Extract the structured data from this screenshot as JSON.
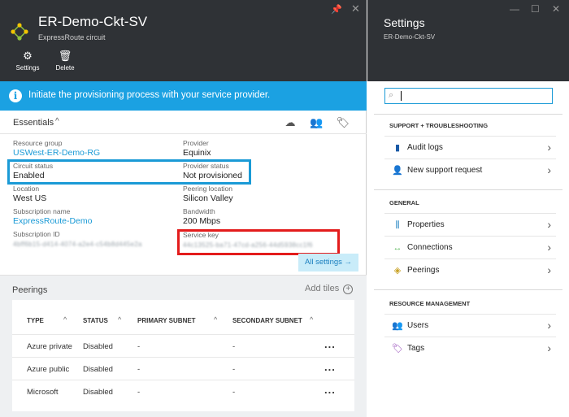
{
  "left_blade": {
    "title": "ER-Demo-Ckt-SV",
    "subtitle": "ExpressRoute circuit",
    "pin_glyph": "📌",
    "close_glyph": "✕",
    "toolbar": [
      {
        "label": "Settings",
        "icon": "gear-icon",
        "glyph": "⚙"
      },
      {
        "label": "Delete",
        "icon": "trash-icon",
        "glyph": "🗑"
      }
    ],
    "banner": {
      "icon": "info-icon",
      "glyph": "i",
      "text": "Initiate the provisioning process with your service provider."
    },
    "essentials": {
      "label": "Essentials",
      "chevron": "^",
      "icons": [
        {
          "name": "cloud-icon",
          "glyph": "☁"
        },
        {
          "name": "users-icon",
          "glyph": "👥"
        },
        {
          "name": "tag-icon",
          "glyph": "🏷"
        }
      ],
      "left_fields": [
        {
          "key": "Resource group",
          "value": "USWest-ER-Demo-RG",
          "link": true
        },
        {
          "key": "Circuit status",
          "value": "Enabled",
          "link": false
        },
        {
          "key": "Location",
          "value": "West US",
          "link": false
        },
        {
          "key": "Subscription name",
          "value": "ExpressRoute-Demo",
          "link": true
        },
        {
          "key": "Subscription ID",
          "value": "4bff6b15-d414-4074-a2e4-c54b8d445e2a",
          "link": false
        }
      ],
      "right_fields": [
        {
          "key": "Provider",
          "value": "Equinix"
        },
        {
          "key": "Provider status",
          "value": "Not provisioned"
        },
        {
          "key": "Peering location",
          "value": "Silicon Valley"
        },
        {
          "key": "Bandwidth",
          "value": "200 Mbps"
        },
        {
          "key": "Service key",
          "value": "44c13525-ba71-47cd-a256-44d5938cc1f6"
        }
      ],
      "all_settings": "All settings →"
    },
    "peerings": {
      "title": "Peerings",
      "add_tiles": "Add tiles",
      "add_glyph": "+",
      "sort_glyph": "^",
      "columns": [
        "TYPE",
        "STATUS",
        "PRIMARY SUBNET",
        "SECONDARY SUBNET"
      ],
      "rows": [
        {
          "type": "Azure private",
          "status": "Disabled",
          "primary": "-",
          "secondary": "-",
          "more": "..."
        },
        {
          "type": "Azure public",
          "status": "Disabled",
          "primary": "-",
          "secondary": "-",
          "more": "..."
        },
        {
          "type": "Microsoft",
          "status": "Disabled",
          "primary": "-",
          "secondary": "-",
          "more": "..."
        }
      ]
    }
  },
  "right_blade": {
    "title": "Settings",
    "subtitle": "ER-Demo-Ckt-SV",
    "window_buttons": [
      {
        "name": "minimize-icon",
        "glyph": "—"
      },
      {
        "name": "maximize-icon",
        "glyph": "☐"
      },
      {
        "name": "close-icon",
        "glyph": "✕"
      }
    ],
    "search": {
      "placeholder": "",
      "glyph": "⌕"
    },
    "sections": [
      {
        "heading": "SUPPORT + TROUBLESHOOTING",
        "items": [
          {
            "label": "Audit logs",
            "icon": "audit-logs-icon",
            "glyph": "▮",
            "color": "#1a5aa6"
          },
          {
            "label": "New support request",
            "icon": "support-person-icon",
            "glyph": "👤",
            "color": "#1a9ad6"
          }
        ]
      },
      {
        "heading": "GENERAL",
        "items": [
          {
            "label": "Properties",
            "icon": "properties-icon",
            "glyph": "⫼",
            "color": "#1a7fbf"
          },
          {
            "label": "Connections",
            "icon": "connections-icon",
            "glyph": "↔",
            "color": "#5cb85c"
          },
          {
            "label": "Peerings",
            "icon": "peerings-icon",
            "glyph": "◈",
            "color": "#c9a227"
          }
        ]
      },
      {
        "heading": "RESOURCE MANAGEMENT",
        "items": [
          {
            "label": "Users",
            "icon": "users-icon",
            "glyph": "👥",
            "color": "#1a9ad6"
          },
          {
            "label": "Tags",
            "icon": "tag-icon",
            "glyph": "🏷",
            "color": "#8e3fb5"
          }
        ]
      }
    ],
    "arrow_glyph": "›"
  }
}
